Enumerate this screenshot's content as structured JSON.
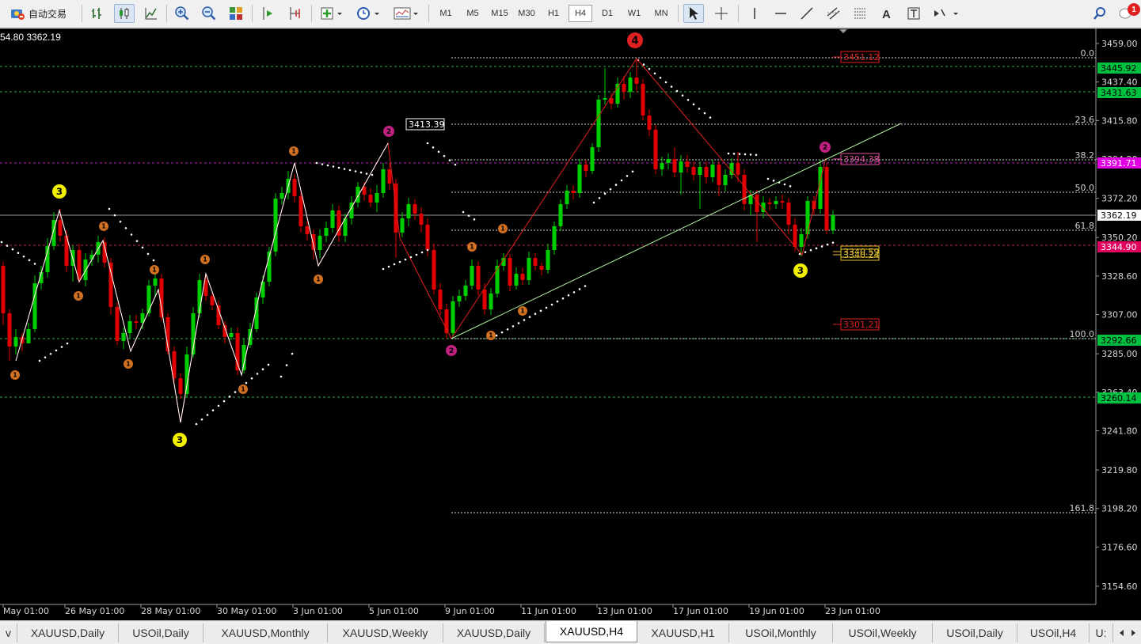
{
  "toolbar": {
    "auto_trade_label": "自动交易",
    "timeframes": [
      "M1",
      "M5",
      "M15",
      "M30",
      "H1",
      "H4",
      "D1",
      "W1",
      "MN"
    ],
    "active_timeframe": "H4",
    "notification_count": "1"
  },
  "chart": {
    "info_text": "54.80 3362.19",
    "background": "#000000",
    "bull_color": "#00d000",
    "bear_color": "#e00000",
    "price_axis": [
      "3459.00",
      "3437.40",
      "3415.80",
      "3394.20",
      "3372.20",
      "3350.20",
      "3328.60",
      "3307.00",
      "3285.00",
      "3263.40",
      "3241.80",
      "3219.80",
      "3198.20",
      "3176.60",
      "3154.60"
    ],
    "price_badges": [
      {
        "value": "3445.92",
        "bg": "#00c040",
        "fg": "#000000"
      },
      {
        "value": "3431.63",
        "bg": "#00c040",
        "fg": "#000000"
      },
      {
        "value": "3391.71",
        "bg": "#e000e0",
        "fg": "#ffffff"
      },
      {
        "value": "3362.19",
        "bg": "#ffffff",
        "fg": "#000000"
      },
      {
        "value": "3344.90",
        "bg": "#e00060",
        "fg": "#ffffff"
      },
      {
        "value": "3292.66",
        "bg": "#00c040",
        "fg": "#000000"
      },
      {
        "value": "3260.14",
        "bg": "#00c040",
        "fg": "#000000"
      }
    ],
    "time_axis": [
      "May 01:00",
      "26 May 01:00",
      "28 May 01:00",
      "30 May 01:00",
      "3 Jun 01:00",
      "5 Jun 01:00",
      "9 Jun 01:00",
      "11 Jun 01:00",
      "13 Jun 01:00",
      "17 Jun 01:00",
      "19 Jun 01:00",
      "23 Jun 01:00"
    ],
    "fib_levels": [
      "0.0",
      "23.6",
      "38.2",
      "50.0",
      "61.8",
      "100.0",
      "161.8"
    ],
    "level_labels": {
      "high": "3451.12",
      "swing_high": "3413.39",
      "upper_pink": "3394.38",
      "lower_yellow_a": "3340.59",
      "lower_yellow_b": "3340.24",
      "low_red": "3301.21"
    },
    "wave_labels": {
      "one": "1",
      "two": "2",
      "three": "3",
      "four": "4"
    }
  },
  "tabs": {
    "items": [
      "v",
      "XAUUSD,Daily",
      "USOil,Daily",
      "XAUUSD,Monthly",
      "XAUUSD,Weekly",
      "XAUUSD,Daily",
      "XAUUSD,H4",
      "XAUUSD,H1",
      "USOil,Monthly",
      "USOil,Weekly",
      "USOil,Daily",
      "USOil,H4",
      "U:"
    ],
    "active": "XAUUSD,H4"
  }
}
